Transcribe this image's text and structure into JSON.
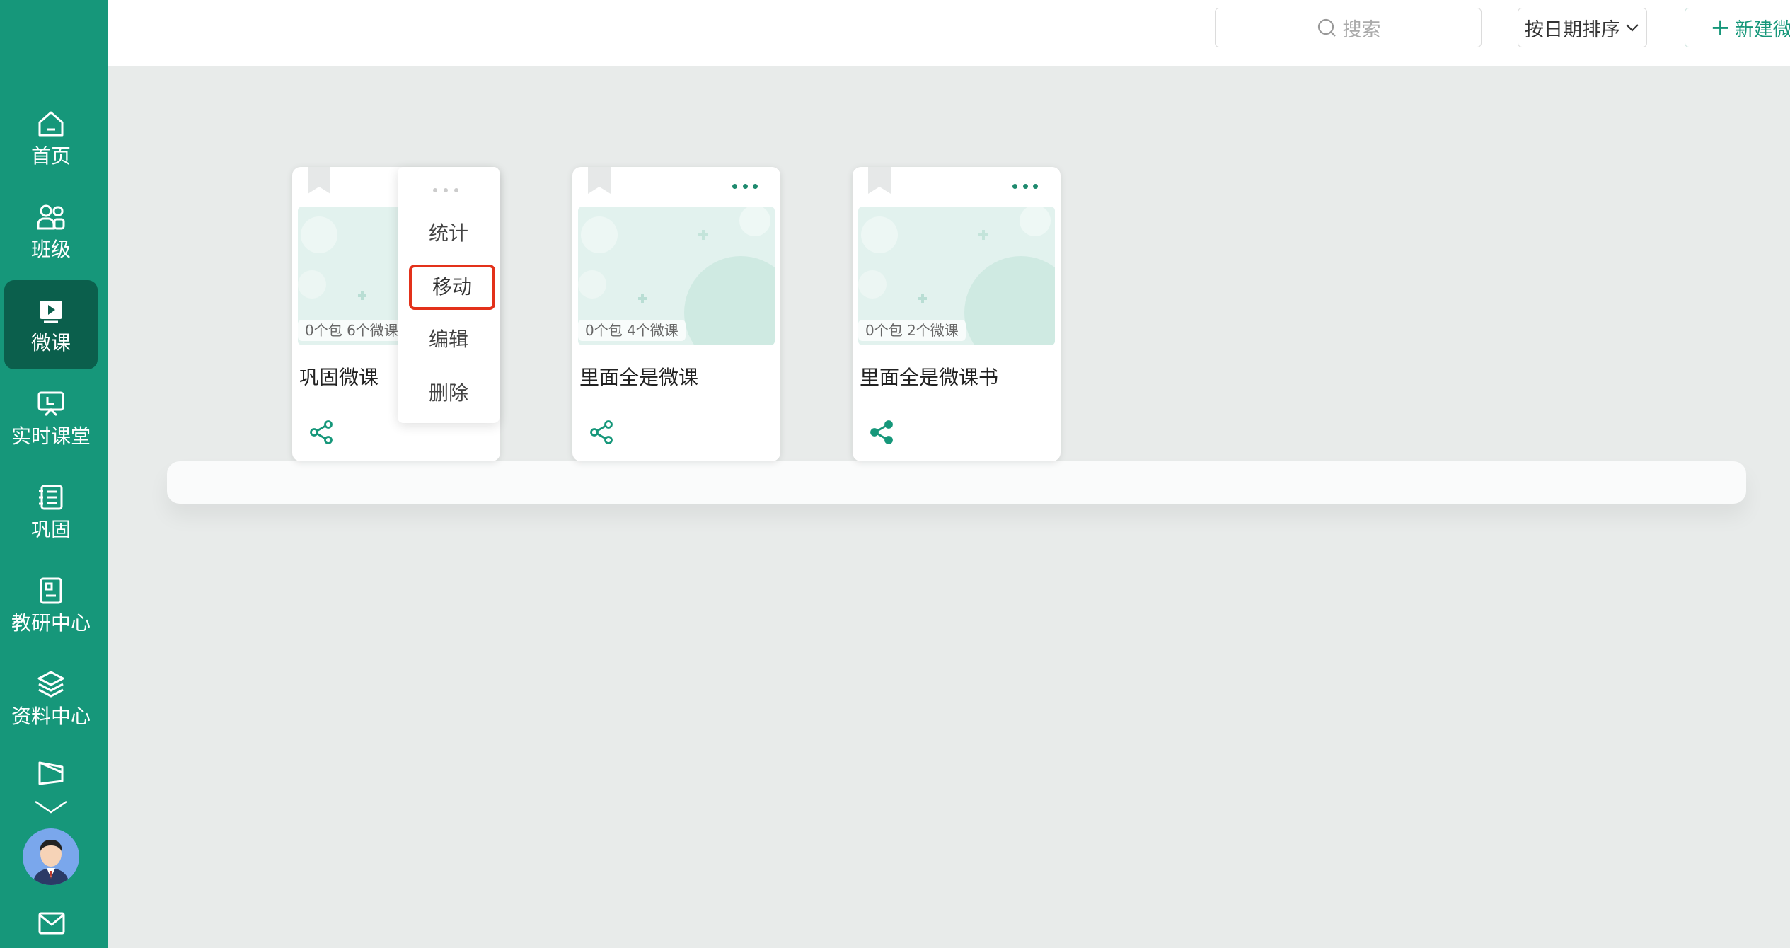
{
  "sidebar": {
    "items": [
      {
        "label": "首页",
        "icon": "home-icon"
      },
      {
        "label": "班级",
        "icon": "users-icon"
      },
      {
        "label": "微课",
        "icon": "video-icon",
        "active": true
      },
      {
        "label": "实时课堂",
        "icon": "classroom-icon"
      },
      {
        "label": "巩固",
        "icon": "list-icon"
      },
      {
        "label": "教研中心",
        "icon": "book-icon"
      },
      {
        "label": "资料中心",
        "icon": "layers-icon"
      }
    ],
    "accent": "#16977a",
    "active_bg": "#0b5f4c"
  },
  "topbar": {
    "search_placeholder": "搜索",
    "sort_label": "按日期排序",
    "new_label": "新建微课包"
  },
  "cards": [
    {
      "title": "巩固微课",
      "count": "0个包  6个微课"
    },
    {
      "title": "里面全是微课",
      "count": "0个包  4个微课"
    },
    {
      "title": "里面全是微课书",
      "count": "0个包  2个微课"
    }
  ],
  "menu": {
    "items": [
      "统计",
      "移动",
      "编辑",
      "删除"
    ],
    "highlighted": "移动",
    "highlight_color": "#e3311a"
  }
}
